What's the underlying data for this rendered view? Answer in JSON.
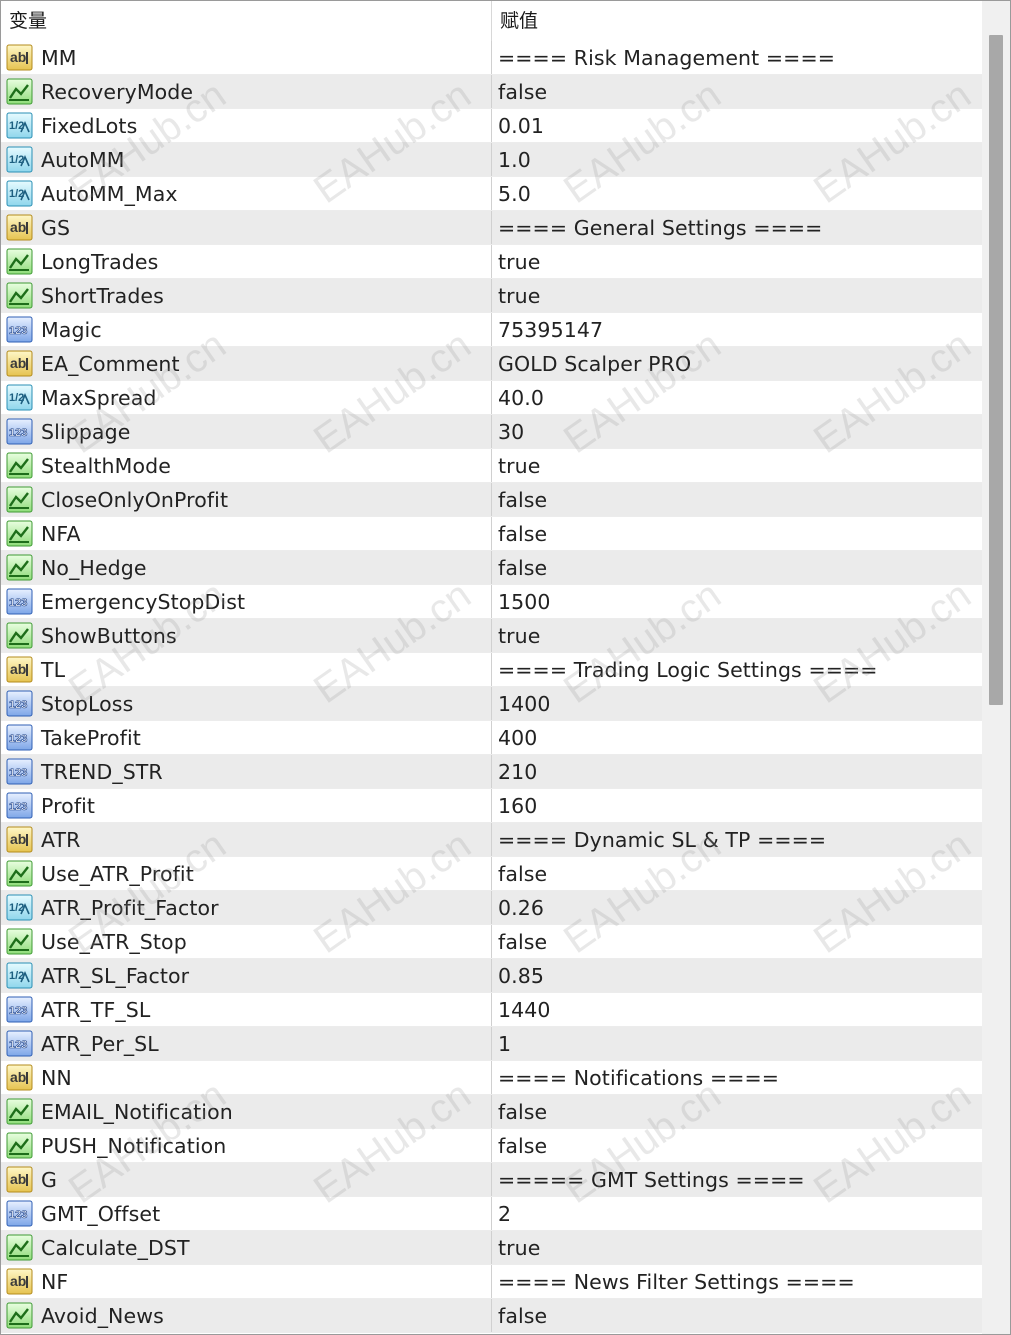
{
  "header": {
    "variable_label": "变量",
    "value_label": "赋值"
  },
  "icon_types": {
    "ab": "string-icon",
    "bool": "boolean-icon",
    "dbl": "double-icon",
    "int": "integer-icon"
  },
  "rows": [
    {
      "icon": "ab",
      "name": "MM",
      "value": "==== Risk Management ===="
    },
    {
      "icon": "bool",
      "name": "RecoveryMode",
      "value": "false"
    },
    {
      "icon": "dbl",
      "name": "FixedLots",
      "value": "0.01"
    },
    {
      "icon": "dbl",
      "name": "AutoMM",
      "value": "1.0"
    },
    {
      "icon": "dbl",
      "name": "AutoMM_Max",
      "value": "5.0"
    },
    {
      "icon": "ab",
      "name": "GS",
      "value": "==== General Settings ===="
    },
    {
      "icon": "bool",
      "name": "LongTrades",
      "value": "true"
    },
    {
      "icon": "bool",
      "name": "ShortTrades",
      "value": "true"
    },
    {
      "icon": "int",
      "name": "Magic",
      "value": "75395147"
    },
    {
      "icon": "ab",
      "name": "EA_Comment",
      "value": "GOLD Scalper PRO"
    },
    {
      "icon": "dbl",
      "name": "MaxSpread",
      "value": "40.0"
    },
    {
      "icon": "int",
      "name": "Slippage",
      "value": "30"
    },
    {
      "icon": "bool",
      "name": "StealthMode",
      "value": "true"
    },
    {
      "icon": "bool",
      "name": "CloseOnlyOnProfit",
      "value": "false"
    },
    {
      "icon": "bool",
      "name": "NFA",
      "value": "false"
    },
    {
      "icon": "bool",
      "name": "No_Hedge",
      "value": "false"
    },
    {
      "icon": "int",
      "name": "EmergencyStopDist",
      "value": "1500"
    },
    {
      "icon": "bool",
      "name": "ShowButtons",
      "value": "true"
    },
    {
      "icon": "ab",
      "name": "TL",
      "value": "==== Trading Logic Settings ===="
    },
    {
      "icon": "int",
      "name": "StopLoss",
      "value": "1400"
    },
    {
      "icon": "int",
      "name": "TakeProfit",
      "value": "400"
    },
    {
      "icon": "int",
      "name": "TREND_STR",
      "value": "210"
    },
    {
      "icon": "int",
      "name": "Profit",
      "value": "160"
    },
    {
      "icon": "ab",
      "name": "ATR",
      "value": "==== Dynamic SL & TP ===="
    },
    {
      "icon": "bool",
      "name": "Use_ATR_Profit",
      "value": "false"
    },
    {
      "icon": "dbl",
      "name": "ATR_Profit_Factor",
      "value": "0.26"
    },
    {
      "icon": "bool",
      "name": "Use_ATR_Stop",
      "value": "false"
    },
    {
      "icon": "dbl",
      "name": "ATR_SL_Factor",
      "value": "0.85"
    },
    {
      "icon": "int",
      "name": "ATR_TF_SL",
      "value": "1440"
    },
    {
      "icon": "int",
      "name": "ATR_Per_SL",
      "value": "1"
    },
    {
      "icon": "ab",
      "name": "NN",
      "value": "==== Notifications ===="
    },
    {
      "icon": "bool",
      "name": "EMAIL_Notification",
      "value": "false"
    },
    {
      "icon": "bool",
      "name": "PUSH_Notification",
      "value": "false"
    },
    {
      "icon": "ab",
      "name": "G",
      "value": "===== GMT Settings ===="
    },
    {
      "icon": "int",
      "name": "GMT_Offset",
      "value": "2"
    },
    {
      "icon": "bool",
      "name": "Calculate_DST",
      "value": "true"
    },
    {
      "icon": "ab",
      "name": "NF",
      "value": "==== News Filter Settings ===="
    },
    {
      "icon": "bool",
      "name": "Avoid_News",
      "value": "false"
    }
  ],
  "watermark_text": "EAHub.cn"
}
